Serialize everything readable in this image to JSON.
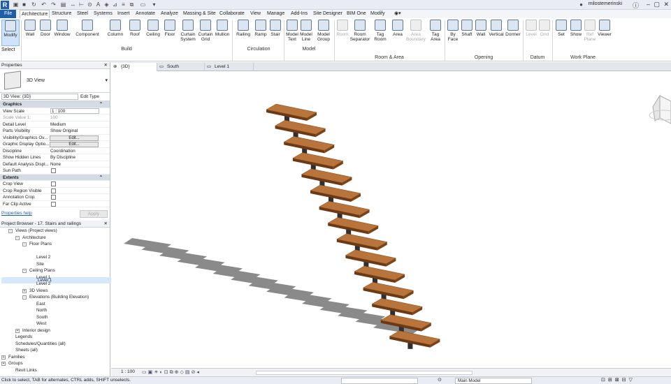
{
  "app": {
    "logo": "R",
    "user": "milostemerinski"
  },
  "tabs": [
    "File",
    "Architecture",
    "Structure",
    "Steel",
    "Systems",
    "Insert",
    "Annotate",
    "Analyze",
    "Massing & Site",
    "Collaborate",
    "View",
    "Manage",
    "Add-Ins",
    "Site Designer",
    "BIM One",
    "Modify"
  ],
  "ribbon": {
    "modify": "Modify",
    "select": "Select",
    "build": [
      "Wall",
      "Door",
      "Window",
      "Component",
      "Column",
      "Roof",
      "Ceiling",
      "Floor",
      "Curtain System",
      "Curtain Grid",
      "Mullion"
    ],
    "build_label": "Build",
    "circulation": [
      "Railing",
      "Ramp",
      "Stair"
    ],
    "circulation_label": "Circulation",
    "model": [
      "Model Text",
      "Model Line",
      "Model Group"
    ],
    "model_label": "Model",
    "room": [
      "Room",
      "Room Separator",
      "Tag Room",
      "Area",
      "Area Boundary",
      "Tag Area"
    ],
    "room_label": "Room & Area",
    "opening": [
      "By Face",
      "Shaft",
      "Wall",
      "Vertical",
      "Dormer"
    ],
    "opening_label": "Opening",
    "datum": [
      "Level",
      "Grid"
    ],
    "datum_label": "Datum",
    "workplane": [
      "Set",
      "Show",
      "Ref Plane",
      "Viewer"
    ],
    "workplane_label": "Work Plane"
  },
  "properties": {
    "title": "Properties",
    "type_name": "3D View",
    "instance": "3D View: {3D}",
    "edit_type": "Edit Type",
    "rows": [
      {
        "k": "Graphics",
        "sec": true
      },
      {
        "k": "View Scale",
        "v": "1 : 100",
        "box": true
      },
      {
        "k": "Scale Value    1:",
        "v": "100",
        "dim": true
      },
      {
        "k": "Detail Level",
        "v": "Medium"
      },
      {
        "k": "Parts Visibility",
        "v": "Show Original"
      },
      {
        "k": "Visibility/Graphics Ov...",
        "btn": "Edit..."
      },
      {
        "k": "Graphic Display Optio...",
        "btn": "Edit..."
      },
      {
        "k": "Discipline",
        "v": "Coordination"
      },
      {
        "k": "Show Hidden Lines",
        "v": "By Discipline"
      },
      {
        "k": "Default Analysis Displ...",
        "v": "None"
      },
      {
        "k": "Sun Path",
        "chk": true
      },
      {
        "k": "Extents",
        "sec": true
      },
      {
        "k": "Crop View",
        "chk": true
      },
      {
        "k": "Crop Region Visible",
        "chk": true
      },
      {
        "k": "Annotation Crop",
        "chk": true
      },
      {
        "k": "Far Clip Active",
        "chk": true
      }
    ],
    "help": "Properties help",
    "apply": "Apply"
  },
  "browser": {
    "title": "Project Browser - 17. Stairs and railings",
    "items": [
      {
        "t": "Views (Project views)",
        "d": 1,
        "g": "-"
      },
      {
        "t": "Architecture",
        "d": 2,
        "g": "-"
      },
      {
        "t": "Floor Plans",
        "d": 3,
        "g": "-"
      },
      {
        "t": "Level 1",
        "d": 4,
        "sel": true
      },
      {
        "t": "Level 2",
        "d": 4
      },
      {
        "t": "Site",
        "d": 4
      },
      {
        "t": "Ceiling Plans",
        "d": 3,
        "g": "-"
      },
      {
        "t": "Level 1",
        "d": 4
      },
      {
        "t": "Level 2",
        "d": 4
      },
      {
        "t": "3D Views",
        "d": 3,
        "g": "+"
      },
      {
        "t": "Elevations (Building Elevation)",
        "d": 3,
        "g": "-"
      },
      {
        "t": "East",
        "d": 4
      },
      {
        "t": "North",
        "d": 4
      },
      {
        "t": "South",
        "d": 4
      },
      {
        "t": "West",
        "d": 4
      },
      {
        "t": "Interior design",
        "d": 2,
        "g": "+"
      },
      {
        "t": "Legends",
        "d": 1
      },
      {
        "t": "Schedules/Quantities (all)",
        "d": 1
      },
      {
        "t": "Sheets (all)",
        "d": 1
      },
      {
        "t": "Families",
        "d": 0,
        "g": "+"
      },
      {
        "t": "Groups",
        "d": 0,
        "g": "+"
      },
      {
        "t": "Revit Links",
        "d": 1
      }
    ]
  },
  "view_tabs": [
    "{3D}",
    "South",
    "Level 1"
  ],
  "viewbar": {
    "scale": "1 : 100"
  },
  "status": {
    "text": "Click to select, TAB for alternates, CTRL adds, SHIFT unselects.",
    "model": "Main Model"
  },
  "stair": {
    "treads": 15
  }
}
